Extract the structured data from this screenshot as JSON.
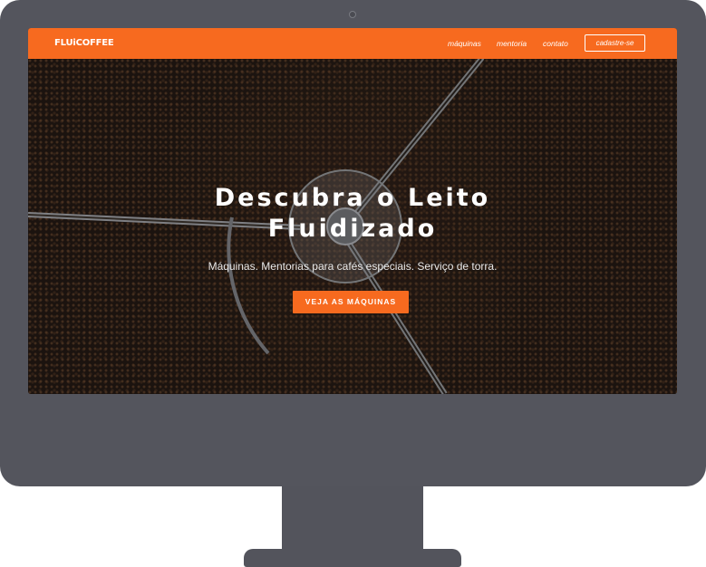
{
  "nav": {
    "logo": "FLUiCOFFEE",
    "links": [
      "máquinas",
      "mentoria",
      "contato"
    ],
    "cta": "cadastre-se"
  },
  "hero": {
    "title_line1": "Descubra o Leito",
    "title_line2": "Fluidizado",
    "subtitle": "Máquinas. Mentorias para cafés especiais. Serviço de torra.",
    "button": "VEJA AS MÁQUINAS"
  },
  "colors": {
    "accent": "#f76a1f",
    "monitor_frame": "#54555d"
  }
}
